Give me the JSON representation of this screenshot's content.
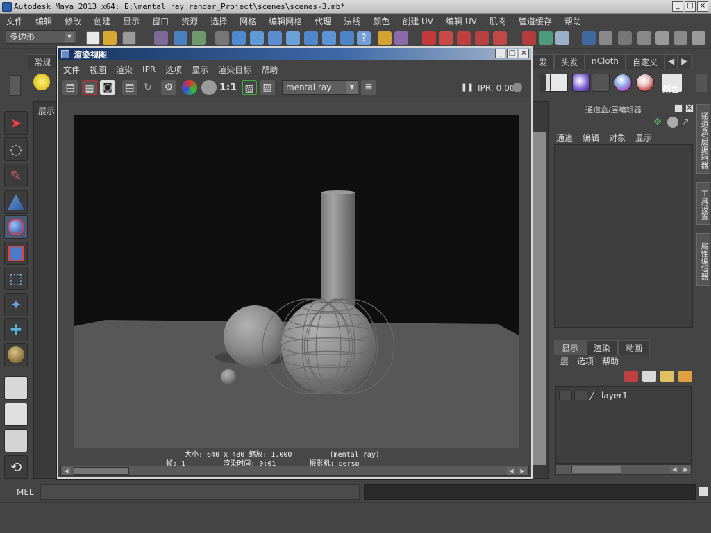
{
  "window": {
    "title": "Autodesk Maya 2013 x64: E:\\mental ray render_Project\\scenes\\scenes-3.mb*",
    "min_label": "_",
    "max_label": "□",
    "close_label": "×"
  },
  "main_menu": [
    "文件",
    "编辑",
    "修改",
    "创建",
    "显示",
    "窗口",
    "资源",
    "选择",
    "网格",
    "编辑网格",
    "代理",
    "法线",
    "颜色",
    "创建 UV",
    "编辑 UV",
    "肌肉",
    "管道缓存",
    "帮助"
  ],
  "status_line": {
    "menu_set": "多边形"
  },
  "shelf": {
    "left_tab": "常规",
    "right_tabs": [
      "头发",
      "nCloth",
      "自定义"
    ],
    "partial_tab": "发",
    "paint_label": "颜色i"
  },
  "viewport": {
    "panel_menu": "展示"
  },
  "render_view": {
    "title": "渲染视图",
    "menu": [
      "文件",
      "视图",
      "渲染",
      "IPR",
      "选项",
      "显示",
      "渲染目标",
      "帮助"
    ],
    "ratio_label": "1:1",
    "renderer": "mental ray",
    "ipr_label": "IPR: 0:00",
    "info_line1": "大小: 640 x 480 缩放: 1.000         (mental ray)",
    "info_line2": "帧: 1         渲染时间: 0:01        摄影机: persp",
    "colors": {
      "background": "#0f0f0f",
      "ground": "#575757",
      "objects": "#8e8e8e"
    }
  },
  "channel_box": {
    "title": "通道盒/层编辑器",
    "menu": [
      "通道",
      "编辑",
      "对象",
      "显示"
    ]
  },
  "layer_editor": {
    "tabs": [
      "显示",
      "渲染",
      "动画"
    ],
    "menu": [
      "层",
      "选项",
      "帮助"
    ],
    "layers": [
      {
        "name": "layer1"
      }
    ]
  },
  "side_tabs": [
    "通道盒/层编辑器",
    "工具设置",
    "属性编辑器"
  ],
  "command_line": {
    "label": "MEL"
  }
}
